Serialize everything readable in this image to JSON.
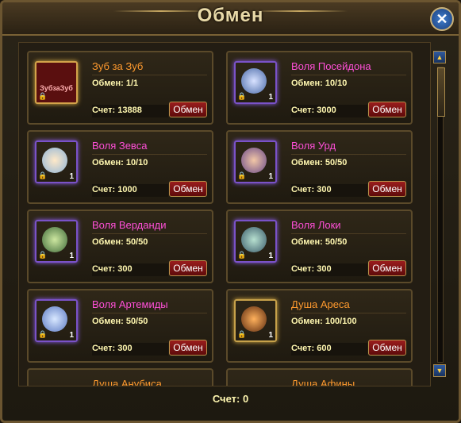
{
  "window": {
    "title": "Обмен",
    "footer_score": "Счет: 0"
  },
  "icons": {
    "close": "close-icon",
    "scroll_up": "arrow-up-icon",
    "scroll_down": "arrow-down-icon"
  },
  "cards": [
    {
      "name": "Зуб за Зуб",
      "exchange": "Обмен: 1/1",
      "score": "Счет: 13888",
      "button": "Обмен",
      "icon_label": "ЗубзаЗуб",
      "qty": ""
    },
    {
      "name": "Воля Посейдона",
      "exchange": "Обмен: 10/10",
      "score": "Счет: 3000",
      "button": "Обмен",
      "qty": "1"
    },
    {
      "name": "Воля Зевса",
      "exchange": "Обмен: 10/10",
      "score": "Счет: 1000",
      "button": "Обмен",
      "qty": "1"
    },
    {
      "name": "Воля Урд",
      "exchange": "Обмен: 50/50",
      "score": "Счет: 300",
      "button": "Обмен",
      "qty": "1"
    },
    {
      "name": "Воля Верданди",
      "exchange": "Обмен: 50/50",
      "score": "Счет: 300",
      "button": "Обмен",
      "qty": "1"
    },
    {
      "name": "Воля Локи",
      "exchange": "Обмен: 50/50",
      "score": "Счет: 300",
      "button": "Обмен",
      "qty": "1"
    },
    {
      "name": "Воля Артемиды",
      "exchange": "Обмен: 50/50",
      "score": "Счет: 300",
      "button": "Обмен",
      "qty": "1"
    },
    {
      "name": "Душа Ареса",
      "exchange": "Обмен: 100/100",
      "score": "Счет: 600",
      "button": "Обмен",
      "qty": "1"
    }
  ],
  "partial_cards": [
    "Душа Анубиса",
    "Душа Афины"
  ],
  "colors": {
    "name_purple": "#ff4fd8",
    "name_orange": "#ff9a2e",
    "accent_gold": "#c7a14a"
  }
}
